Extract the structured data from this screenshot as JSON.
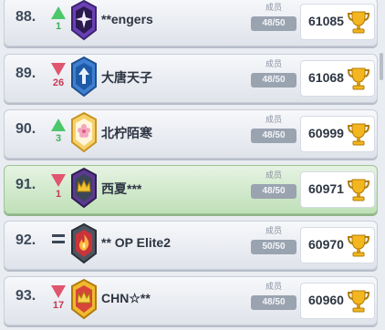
{
  "screen": {
    "members_label": "成员"
  },
  "clans": [
    {
      "rank": "88.",
      "trend": "up",
      "delta": "1",
      "badge": "purple-star-badge",
      "name": "**engers",
      "members": "48/50",
      "trophies": "61085"
    },
    {
      "rank": "89.",
      "trend": "down",
      "delta": "26",
      "badge": "blue-arrow-badge",
      "name": "大唐天子",
      "members": "48/50",
      "trophies": "61068"
    },
    {
      "rank": "90.",
      "trend": "up",
      "delta": "3",
      "badge": "gold-flower-badge",
      "name": "北柠陌寒",
      "members": "48/50",
      "trophies": "60999"
    },
    {
      "rank": "91.",
      "trend": "down",
      "delta": "1",
      "badge": "purple-crown-badge",
      "name": "西夏***",
      "members": "48/50",
      "trophies": "60971"
    },
    {
      "rank": "92.",
      "trend": "same",
      "delta": "",
      "badge": "red-fire-badge",
      "name": "** OP Elite2",
      "members": "50/50",
      "trophies": "60970"
    },
    {
      "rank": "93.",
      "trend": "down",
      "delta": "17",
      "badge": "gold-crown-badge",
      "name": "CHN☆**",
      "members": "48/50",
      "trophies": "60960"
    }
  ],
  "colors": {
    "up": "#4cc76a",
    "down": "#e0556f",
    "highlight_row": "#c9e7c2"
  }
}
